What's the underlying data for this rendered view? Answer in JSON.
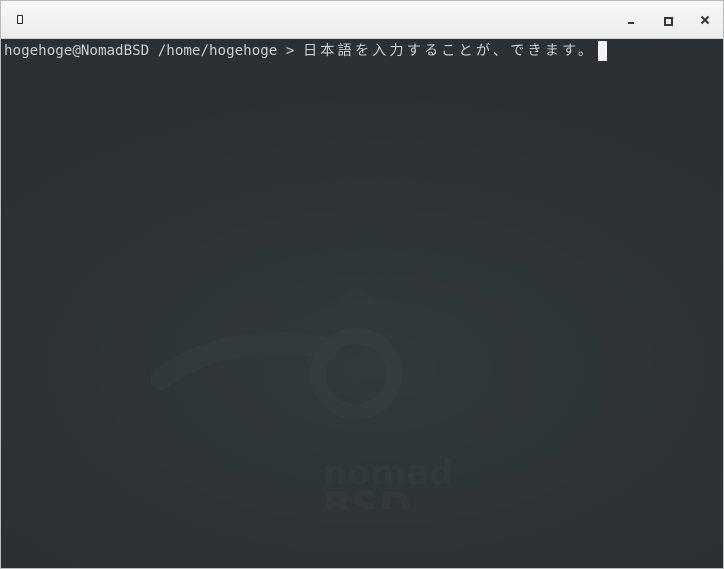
{
  "window": {
    "controls": {
      "minimize": "minimize",
      "maximize": "maximize",
      "close": "close"
    }
  },
  "terminal": {
    "prompt": "hogehoge@NomadBSD /home/hogehoge > ",
    "input": "日本語を入力することが、できます。",
    "watermark": {
      "line1": "nomad",
      "line2": "BSD"
    }
  },
  "colors": {
    "titlebar": "#f0f0f0",
    "terminal_background": "#2e3437",
    "text": "#c9d0d2",
    "cursor": "#f4f4f4"
  }
}
